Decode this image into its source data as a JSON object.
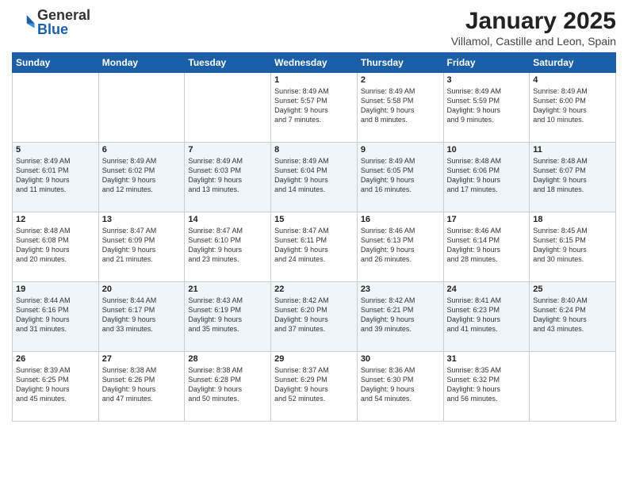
{
  "header": {
    "logo_general": "General",
    "logo_blue": "Blue",
    "month_year": "January 2025",
    "location": "Villamol, Castille and Leon, Spain"
  },
  "weekdays": [
    "Sunday",
    "Monday",
    "Tuesday",
    "Wednesday",
    "Thursday",
    "Friday",
    "Saturday"
  ],
  "weeks": [
    [
      {
        "day": "",
        "text": ""
      },
      {
        "day": "",
        "text": ""
      },
      {
        "day": "",
        "text": ""
      },
      {
        "day": "1",
        "text": "Sunrise: 8:49 AM\nSunset: 5:57 PM\nDaylight: 9 hours\nand 7 minutes."
      },
      {
        "day": "2",
        "text": "Sunrise: 8:49 AM\nSunset: 5:58 PM\nDaylight: 9 hours\nand 8 minutes."
      },
      {
        "day": "3",
        "text": "Sunrise: 8:49 AM\nSunset: 5:59 PM\nDaylight: 9 hours\nand 9 minutes."
      },
      {
        "day": "4",
        "text": "Sunrise: 8:49 AM\nSunset: 6:00 PM\nDaylight: 9 hours\nand 10 minutes."
      }
    ],
    [
      {
        "day": "5",
        "text": "Sunrise: 8:49 AM\nSunset: 6:01 PM\nDaylight: 9 hours\nand 11 minutes."
      },
      {
        "day": "6",
        "text": "Sunrise: 8:49 AM\nSunset: 6:02 PM\nDaylight: 9 hours\nand 12 minutes."
      },
      {
        "day": "7",
        "text": "Sunrise: 8:49 AM\nSunset: 6:03 PM\nDaylight: 9 hours\nand 13 minutes."
      },
      {
        "day": "8",
        "text": "Sunrise: 8:49 AM\nSunset: 6:04 PM\nDaylight: 9 hours\nand 14 minutes."
      },
      {
        "day": "9",
        "text": "Sunrise: 8:49 AM\nSunset: 6:05 PM\nDaylight: 9 hours\nand 16 minutes."
      },
      {
        "day": "10",
        "text": "Sunrise: 8:48 AM\nSunset: 6:06 PM\nDaylight: 9 hours\nand 17 minutes."
      },
      {
        "day": "11",
        "text": "Sunrise: 8:48 AM\nSunset: 6:07 PM\nDaylight: 9 hours\nand 18 minutes."
      }
    ],
    [
      {
        "day": "12",
        "text": "Sunrise: 8:48 AM\nSunset: 6:08 PM\nDaylight: 9 hours\nand 20 minutes."
      },
      {
        "day": "13",
        "text": "Sunrise: 8:47 AM\nSunset: 6:09 PM\nDaylight: 9 hours\nand 21 minutes."
      },
      {
        "day": "14",
        "text": "Sunrise: 8:47 AM\nSunset: 6:10 PM\nDaylight: 9 hours\nand 23 minutes."
      },
      {
        "day": "15",
        "text": "Sunrise: 8:47 AM\nSunset: 6:11 PM\nDaylight: 9 hours\nand 24 minutes."
      },
      {
        "day": "16",
        "text": "Sunrise: 8:46 AM\nSunset: 6:13 PM\nDaylight: 9 hours\nand 26 minutes."
      },
      {
        "day": "17",
        "text": "Sunrise: 8:46 AM\nSunset: 6:14 PM\nDaylight: 9 hours\nand 28 minutes."
      },
      {
        "day": "18",
        "text": "Sunrise: 8:45 AM\nSunset: 6:15 PM\nDaylight: 9 hours\nand 30 minutes."
      }
    ],
    [
      {
        "day": "19",
        "text": "Sunrise: 8:44 AM\nSunset: 6:16 PM\nDaylight: 9 hours\nand 31 minutes."
      },
      {
        "day": "20",
        "text": "Sunrise: 8:44 AM\nSunset: 6:17 PM\nDaylight: 9 hours\nand 33 minutes."
      },
      {
        "day": "21",
        "text": "Sunrise: 8:43 AM\nSunset: 6:19 PM\nDaylight: 9 hours\nand 35 minutes."
      },
      {
        "day": "22",
        "text": "Sunrise: 8:42 AM\nSunset: 6:20 PM\nDaylight: 9 hours\nand 37 minutes."
      },
      {
        "day": "23",
        "text": "Sunrise: 8:42 AM\nSunset: 6:21 PM\nDaylight: 9 hours\nand 39 minutes."
      },
      {
        "day": "24",
        "text": "Sunrise: 8:41 AM\nSunset: 6:23 PM\nDaylight: 9 hours\nand 41 minutes."
      },
      {
        "day": "25",
        "text": "Sunrise: 8:40 AM\nSunset: 6:24 PM\nDaylight: 9 hours\nand 43 minutes."
      }
    ],
    [
      {
        "day": "26",
        "text": "Sunrise: 8:39 AM\nSunset: 6:25 PM\nDaylight: 9 hours\nand 45 minutes."
      },
      {
        "day": "27",
        "text": "Sunrise: 8:38 AM\nSunset: 6:26 PM\nDaylight: 9 hours\nand 47 minutes."
      },
      {
        "day": "28",
        "text": "Sunrise: 8:38 AM\nSunset: 6:28 PM\nDaylight: 9 hours\nand 50 minutes."
      },
      {
        "day": "29",
        "text": "Sunrise: 8:37 AM\nSunset: 6:29 PM\nDaylight: 9 hours\nand 52 minutes."
      },
      {
        "day": "30",
        "text": "Sunrise: 8:36 AM\nSunset: 6:30 PM\nDaylight: 9 hours\nand 54 minutes."
      },
      {
        "day": "31",
        "text": "Sunrise: 8:35 AM\nSunset: 6:32 PM\nDaylight: 9 hours\nand 56 minutes."
      },
      {
        "day": "",
        "text": ""
      }
    ]
  ]
}
